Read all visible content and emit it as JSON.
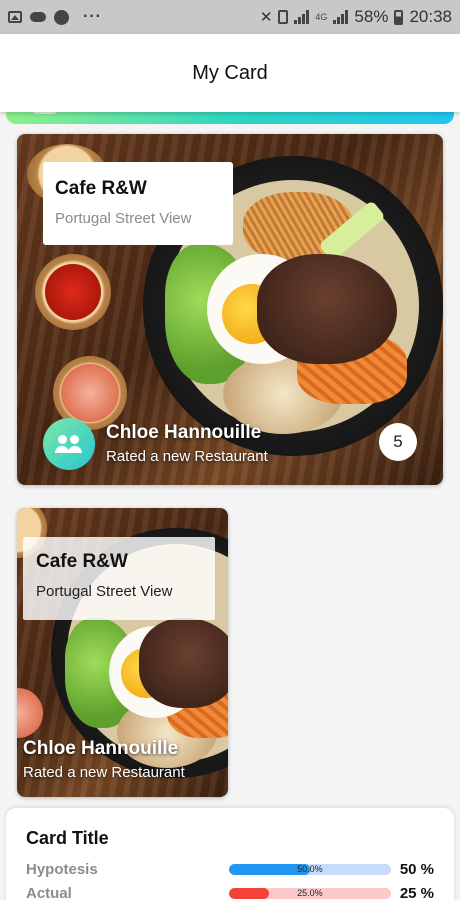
{
  "status_bar": {
    "left_icons": [
      "image-icon",
      "cloud-icon",
      "whatsapp-icon",
      "more-icon"
    ],
    "more_label": "···",
    "network_label": "4G",
    "battery_label": "58%",
    "time": "20:38"
  },
  "app_bar": {
    "title": "My Card"
  },
  "cards": [
    {
      "title": "Cafe R&W",
      "subtitle": "Portugal Street View",
      "poster_name": "Chloe Hannouille",
      "poster_action": "Rated a new Restaurant",
      "count": "5",
      "avatar_icon": "people-icon"
    },
    {
      "title": "Cafe R&W",
      "subtitle": "Portugal Street View",
      "poster_name": "Chloe Hannouille",
      "poster_action": "Rated a new Restaurant"
    }
  ],
  "stats_card": {
    "title": "Card Title",
    "rows": [
      {
        "label": "Hypotesis",
        "fraction": 0.5,
        "bar_text": "50.0%",
        "value": "50 %",
        "color": "#2196f3",
        "track": "#c7dcfb"
      },
      {
        "label": "Actual",
        "fraction": 0.25,
        "bar_text": "25.0%",
        "value": "25 %",
        "color": "#f44336",
        "track": "#fbc9c9"
      }
    ]
  },
  "colors": {
    "accent_gradient": [
      "#7ee8a6",
      "#26c6d0"
    ],
    "status_bar": "#c8c8c8"
  }
}
